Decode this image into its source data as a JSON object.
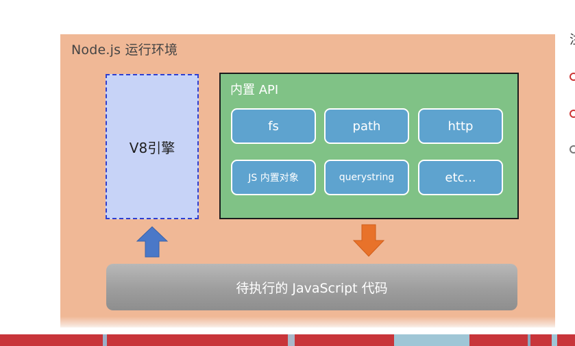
{
  "diagram": {
    "environment_title": "Node.js 运行环境",
    "v8_label": "V8引擎",
    "api_title": "内置 API",
    "api_items": [
      {
        "label": "fs"
      },
      {
        "label": "path"
      },
      {
        "label": "http"
      },
      {
        "label": "JS 内置对象"
      },
      {
        "label": "querystring"
      },
      {
        "label": "etc..."
      }
    ],
    "code_label": "待执行的 JavaScript 代码"
  },
  "side_panel": {
    "glyph": "注"
  },
  "colors": {
    "environment_bg": "#f0b896",
    "v8_bg": "#c7d3f7",
    "v8_border": "#2e3fd0",
    "api_bg": "#80c286",
    "api_button": "#5ea3cf",
    "up_arrow": "#4a78c8",
    "down_arrow": "#e8722a",
    "code_bar": "#a5a5a5",
    "bottom_band": "#c8353a"
  },
  "icons": {
    "up_arrow": "arrow-up-icon",
    "down_arrow": "arrow-down-icon"
  }
}
